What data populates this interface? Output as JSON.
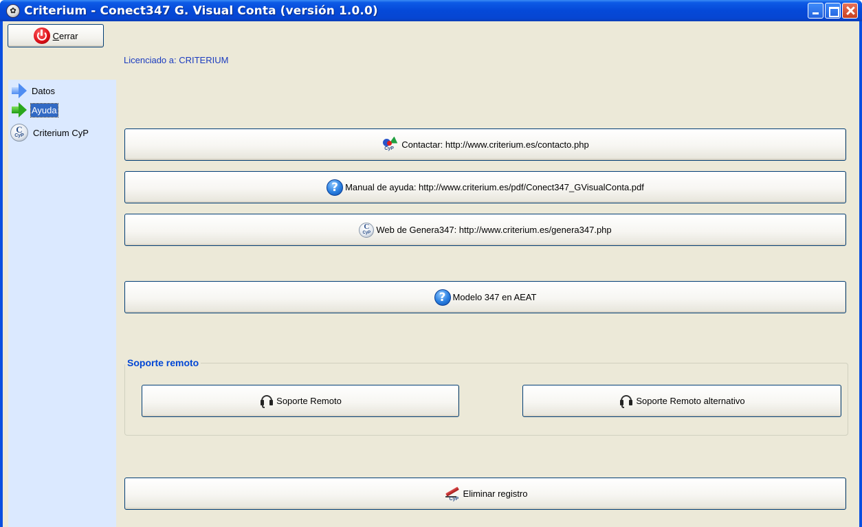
{
  "window": {
    "title": "Criterium - Conect347 G. Visual Conta (versión 1.0.0)",
    "app_icon": "criterium-app-icon",
    "caption_buttons": [
      "minimize",
      "maximize",
      "close"
    ]
  },
  "toolbar": {
    "close_label_accel": "C",
    "close_label_rest": "errar",
    "close_icon": "power-icon",
    "license_text": "Licenciado a: CRITERIUM"
  },
  "sidebar": {
    "items": [
      {
        "label": "Datos",
        "icon": "arrow-right-blue-icon",
        "selected": false
      },
      {
        "label": "Ayuda",
        "icon": "arrow-right-green-icon",
        "selected": true
      },
      {
        "label": "Criterium CyP",
        "icon": "criterium-cyp-icon",
        "selected": false
      }
    ]
  },
  "main": {
    "buttons": [
      {
        "label": "Contactar: http://www.criterium.es/contacto.php",
        "icon": "contact-icon"
      },
      {
        "label": "Manual de ayuda: http://www.criterium.es/pdf/Conect347_GVisualConta.pdf",
        "icon": "help-icon"
      },
      {
        "label": "Web de Genera347: http://www.criterium.es/genera347.php",
        "icon": "criterium-cyp-icon"
      },
      {
        "label": "Modelo 347 en AEAT",
        "icon": "help-icon"
      }
    ],
    "remote_support": {
      "legend": "Soporte remoto",
      "buttons": [
        {
          "label": "Soporte Remoto",
          "icon": "headset-icon"
        },
        {
          "label": "Soporte Remoto alternativo",
          "icon": "headset-icon"
        }
      ]
    },
    "erase_button": {
      "label": "Eliminar registro",
      "icon": "erase-icon"
    }
  },
  "colors": {
    "titlebar": "#0549d8",
    "client_bg": "#ece9d8",
    "sidebar_bg": "#dbe9ff",
    "selection": "#316ac5",
    "license_text": "#1a3bbf",
    "group_legend": "#0046d5"
  }
}
